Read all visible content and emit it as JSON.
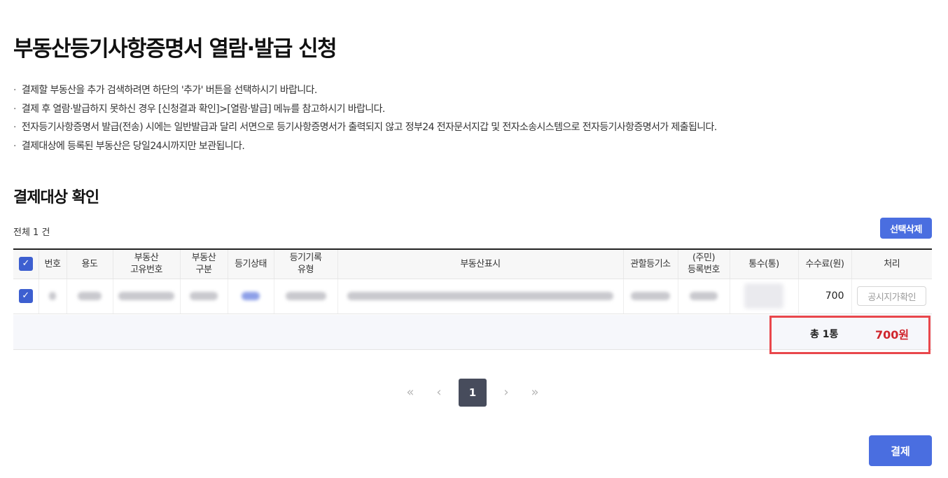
{
  "page": {
    "title": "부동산등기사항증명서 열람·발급 신청",
    "notes": [
      "결제할 부동산을 추가 검색하려면 하단의 '추가' 버튼을 선택하시기 바랍니다.",
      "결제 후 열람·발급하지 못하신 경우 [신청결과 확인]>[열람·발급] 메뉴를 참고하시기 바랍니다.",
      "전자등기사항증명서 발급(전송) 시에는 일반발급과 달리 서면으로 등기사항증명서가 출력되지 않고 정부24 전자문서지갑 및 전자소송시스템으로 전자등기사항증명서가 제출됩니다.",
      "결제대상에 등록된 부동산은 당일24시까지만 보관됩니다."
    ]
  },
  "section": {
    "title": "결제대상 확인",
    "total_label": "전체 1 건",
    "delete_button": "선택삭제"
  },
  "table": {
    "headers": {
      "no": "번호",
      "usage": "용도",
      "unique_no_1": "부동산",
      "unique_no_2": "고유번호",
      "type_1": "부동산",
      "type_2": "구분",
      "status": "등기상태",
      "record_1": "등기기록",
      "record_2": "유형",
      "display": "부동산표시",
      "office": "관할등기소",
      "reg_1": "(주민)",
      "reg_2": "등록번호",
      "copies": "통수(통)",
      "fee": "수수료(원)",
      "action": "처리"
    },
    "rows": [
      {
        "fee": "700",
        "action_label": "공시지가확인"
      }
    ]
  },
  "summary": {
    "count": "총 1통",
    "amount": "700원"
  },
  "pagination": {
    "first": "«",
    "prev": "‹",
    "current": "1",
    "next": "›",
    "last": "»"
  },
  "pay_button": "결제",
  "colors": {
    "primary": "#4a6ee0",
    "highlight_border": "#e9474c",
    "amount": "#d0262d",
    "pager_active": "#474c5c"
  }
}
